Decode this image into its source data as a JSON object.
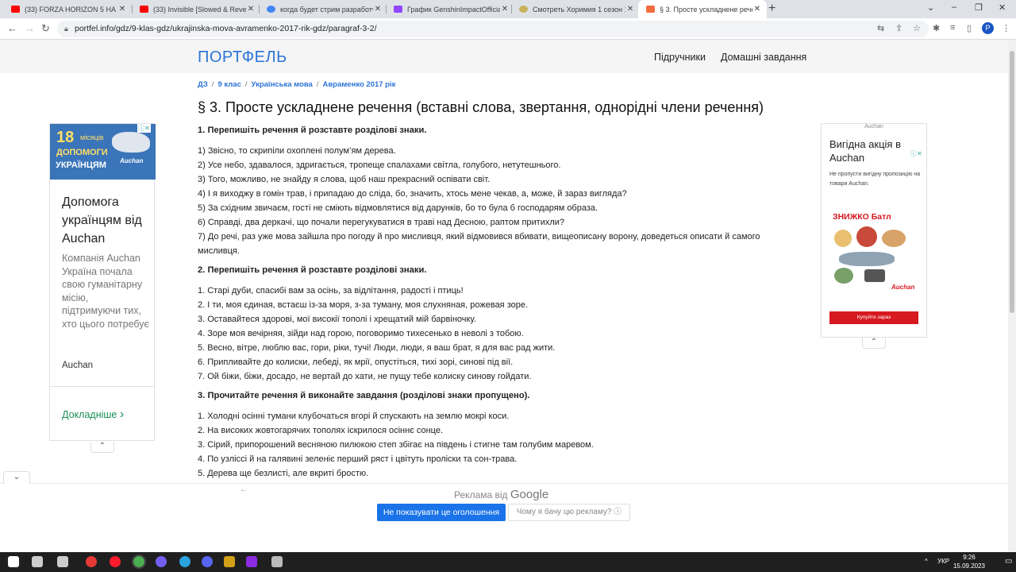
{
  "browser": {
    "tabs": [
      {
        "title": "(33) FORZA HORIZON 5 НА ПОД",
        "icon": "youtube-icon",
        "color": "#ff0000",
        "active": false
      },
      {
        "title": "(33) Invisible [Slowed & Reve",
        "icon": "youtube-icon",
        "color": "#ff0000",
        "active": false
      },
      {
        "title": "когда будет стрим разработчик",
        "icon": "google-icon",
        "color": "#4285f4",
        "active": false
      },
      {
        "title": "График GenshinImpactOfficial - ",
        "icon": "twitch-icon",
        "color": "#9146ff",
        "active": false
      },
      {
        "title": "Смотреть Хоримия 1 сезон 12 с",
        "icon": "anime-site-icon",
        "color": "#c9b35a",
        "active": false
      },
      {
        "title": "§ 3. Просте ускладнене речення",
        "icon": "portfel-icon",
        "color": "#f26d3d",
        "active": true
      }
    ],
    "new_tab": "+",
    "url": "portfel.info/gdz/9-klas-gdz/ukrajinska-mova-avramenko-2017-rik-gdz/paragraf-3-2/",
    "profile_initial": "P",
    "window_controls": [
      "⌄",
      "–",
      "❐",
      "✕"
    ]
  },
  "site": {
    "logo": "ПОРТФЕЛЬ",
    "nav": [
      "Підручники",
      "Домашні завдання"
    ]
  },
  "breadcrumbs": [
    "ДЗ",
    "9 клас",
    "Українська мова",
    "Авраменко 2017 рік"
  ],
  "page_title": "§ 3. Просте ускладнене речення (вставні слова, звертання, однорідні члени речення)",
  "sections": [
    {
      "heading": "1. Перепишіть речення й розставте розділові знаки.",
      "lines": [
        "1) Звісно, то скрипіли охоплені полум’ям дерева.",
        "2) Усе небо, здавалося, здригається, тропеще спалахами світла, голубого, нетутешнього.",
        "3) Того, можливо, не знайду я слова, щоб наш прекрасний оспівати світ.",
        "4) І я виходжу в гомін трав, і припадаю до сліда, бо, значить, хтось мене чекав, а, може, й зараз вигляда?",
        "5) За східним звичаєм, гості не сміють відмовлятися від дарунків, бо то була б господарям образа.",
        "6) Справді, два деркачі, що почали перегукуватися в траві над Десною, раптом притихли?",
        "7) До речі, раз уже мова зайшла про погоду й про мисливця, який відмовився вбивати, вищеописану ворону, доведеться описати й самого мисливця."
      ]
    },
    {
      "heading": "2. Перепишіть речення й розставте розділові знаки.",
      "lines": [
        "1. Старі дуби, спасибі вам за осінь, за відлітання, радості і птиць!",
        "2. І ти, моя єдиная, встаєш із-за моря, з-за туману, моя слухняная, рожевая зоре.",
        "3. Оставайтеся здорові, мої високії тополі і хрещатий мій барвіночку.",
        "4. Зоре моя вечірняя, зійди над горою, поговоримо тихесенько в неволі з тобою.",
        "5. Весно, вітре, люблю вас, гори, ріки, тучі! Люди, люди, я ваш брат, я для вас рад жити.",
        "6. Припливайте до колиски, лебеді, як мрії, опустіться, тихі зорі, синові під вії.",
        "7. Ой біжи, біжи, досадо, не вертай до хати, не пущу тебе колиску синову гойдати."
      ]
    },
    {
      "heading": "3. Прочитайте речення й виконайте завдання (розділові знаки пропущено).",
      "lines": [
        "1. Холодні осінні тумани клубочаться вгорі й спускають на землю мокрі коси.",
        "2. На високих жовтогарячих тополях іскрилося осіннє сонце.",
        "3. Сірий, припорошений весняною пилюкою степ збігає на південь і стигне там голубим маревом.",
        "4. По узліссі й на галявині зеленіє перший ряст і цвітуть проліски та сон-трава.",
        "5. Дерева ще безлисті, але вкриті бростю."
      ]
    }
  ],
  "ad_left": {
    "badge_number": "18",
    "badge_months": "місяців",
    "badge_help": "ДОПОМОГИ",
    "badge_ukr": "УКРАЇНЦЯМ",
    "badge_brand": "Auchan",
    "title": "Допомога українцям від Auchan",
    "description": "Компанія Auchan Україна почала свою гуманітарну місію, підтримуючи тих, хто цього потребує",
    "brand": "Auchan",
    "more": "Докладніше",
    "more_icon": "›",
    "collapse_icon": "⌃"
  },
  "ad_right": {
    "source": "Auchan",
    "title": "Вигідна акція в Auchan",
    "description": "Не пропусти вигідну пропозицію на товари Auchan.",
    "sale": "ЗНИЖКО Батл",
    "brand": "Auchan",
    "cta": "Купуйте зараз",
    "collapse_icon": "⌃"
  },
  "google_bar": {
    "label": "Реклама від",
    "google": "Google",
    "stop_button": "Не показувати це оголошення",
    "why_button": "Чому я бачу цю рекламу? ⓘ",
    "back_icon": "←",
    "collapse_icon": "⌄"
  },
  "taskbar": {
    "lang": "УКР",
    "time": "9:26",
    "date": "15.09.2023",
    "apps": [
      {
        "name": "start-icon",
        "color": "#ffffff"
      },
      {
        "name": "search-icon",
        "color": "#cccccc"
      },
      {
        "name": "task-view-icon",
        "color": "#cccccc"
      },
      {
        "name": "recorder-icon",
        "color": "#e53935"
      },
      {
        "name": "opera-icon",
        "color": "#ff1b2d"
      },
      {
        "name": "chrome-icon",
        "color": "#4caf50"
      },
      {
        "name": "viber-icon",
        "color": "#7360f2"
      },
      {
        "name": "telegram-icon",
        "color": "#2aa3df"
      },
      {
        "name": "discord-icon",
        "color": "#5865f2"
      },
      {
        "name": "wow-icon",
        "color": "#d4a017"
      },
      {
        "name": "winrar-icon",
        "color": "#8b2be2"
      },
      {
        "name": "game-icon",
        "color": "#bbbbbb"
      }
    ]
  }
}
